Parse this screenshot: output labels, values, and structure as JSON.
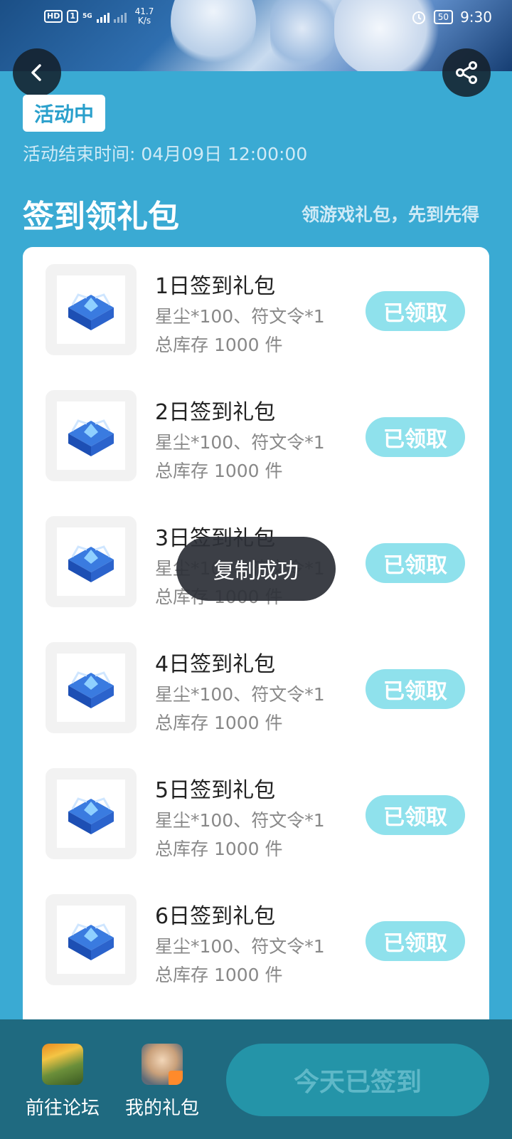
{
  "status_bar": {
    "hd_label": "HD",
    "sim_label": "1",
    "network_label": "5G",
    "speed_value": "41.7",
    "speed_unit": "K/s",
    "battery": "50",
    "time": "9:30"
  },
  "header": {
    "back_icon": "chevron-left-icon",
    "share_icon": "share-icon"
  },
  "activity": {
    "status_tag": "活动中",
    "end_time": "活动结束时间: 04月09日 12:00:00"
  },
  "section": {
    "title": "签到领礼包",
    "subtitle": "领游戏礼包，先到先得"
  },
  "gifts": [
    {
      "name": "1日签到礼包",
      "desc": "星尘*100、符文令*1",
      "stock": "总库存 1000 件",
      "button": "已领取"
    },
    {
      "name": "2日签到礼包",
      "desc": "星尘*100、符文令*1",
      "stock": "总库存 1000 件",
      "button": "已领取"
    },
    {
      "name": "3日签到礼包",
      "desc": "星尘*100、符文令*1",
      "stock": "总库存 1000 件",
      "button": "已领取"
    },
    {
      "name": "4日签到礼包",
      "desc": "星尘*100、符文令*1",
      "stock": "总库存 1000 件",
      "button": "已领取"
    },
    {
      "name": "5日签到礼包",
      "desc": "星尘*100、符文令*1",
      "stock": "总库存 1000 件",
      "button": "已领取"
    },
    {
      "name": "6日签到礼包",
      "desc": "星尘*100、符文令*1",
      "stock": "总库存 1000 件",
      "button": "已领取"
    }
  ],
  "toast": {
    "message": "复制成功"
  },
  "bottom": {
    "forum_label": "前往论坛",
    "mygift_label": "我的礼包",
    "sign_button": "今天已签到"
  },
  "colors": {
    "page_bg": "#3aaad3",
    "claimed_button": "#8fe1ec",
    "bottom_bar": "#1f6a80",
    "sign_button_bg": "#2494a8"
  }
}
